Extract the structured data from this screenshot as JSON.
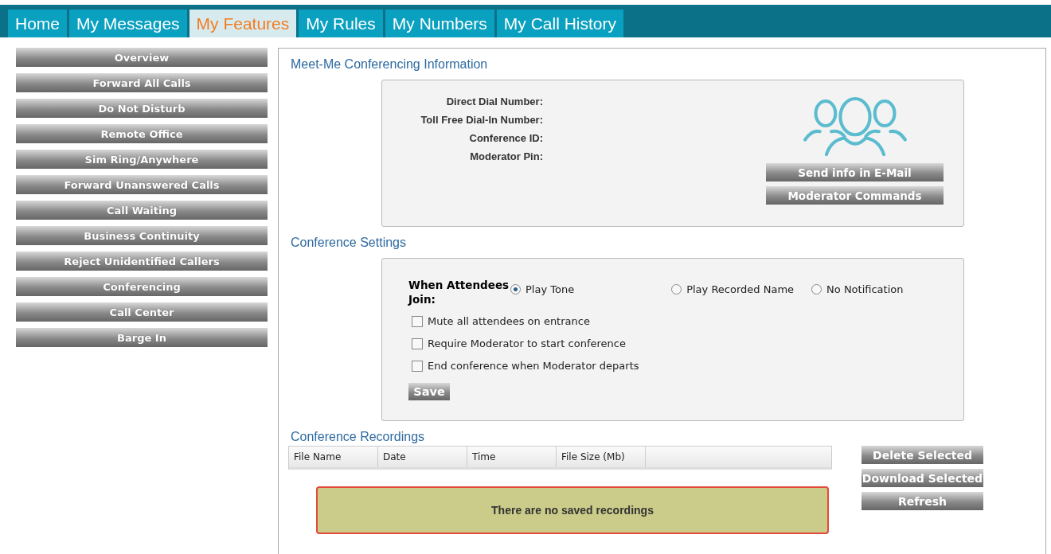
{
  "tabs": [
    {
      "label": "Home",
      "selected": false
    },
    {
      "label": "My Messages",
      "selected": false
    },
    {
      "label": "My Features",
      "selected": true
    },
    {
      "label": "My Rules",
      "selected": false
    },
    {
      "label": "My Numbers",
      "selected": false
    },
    {
      "label": "My Call History",
      "selected": false
    }
  ],
  "sidebar": {
    "items": [
      "Overview",
      "Forward All Calls",
      "Do Not Disturb",
      "Remote Office",
      "Sim Ring/Anywhere",
      "Forward Unanswered Calls",
      "Call Waiting",
      "Business Continuity",
      "Reject Unidentified Callers",
      "Conferencing",
      "Call Center",
      "Barge In"
    ]
  },
  "conference_info": {
    "title": "Meet-Me Conferencing Information",
    "fields": [
      "Direct Dial Number:",
      "Toll Free Dial-In Number:",
      "Conference ID:",
      "Moderator Pin:"
    ],
    "buttons": [
      "Send info in E-Mail",
      "Moderator Commands"
    ]
  },
  "conference_settings": {
    "title": "Conference Settings",
    "join_label": "When Attendees Join:",
    "join_options": [
      {
        "label": "Play Tone",
        "selected": true
      },
      {
        "label": "Play Recorded Name",
        "selected": false
      },
      {
        "label": "No Notification",
        "selected": false
      }
    ],
    "checkboxes": [
      {
        "label": "Mute all attendees on entrance",
        "checked": false
      },
      {
        "label": "Require Moderator to start conference",
        "checked": false
      },
      {
        "label": "End conference when Moderator departs",
        "checked": false
      }
    ],
    "save_button": "Save"
  },
  "recordings": {
    "title": "Conference Recordings",
    "columns": [
      "File Name",
      "Date",
      "Time",
      "File Size (Mb)"
    ],
    "empty_message": "There are no saved recordings",
    "buttons": [
      "Delete Selected",
      "Download Selected",
      "Refresh"
    ]
  }
}
